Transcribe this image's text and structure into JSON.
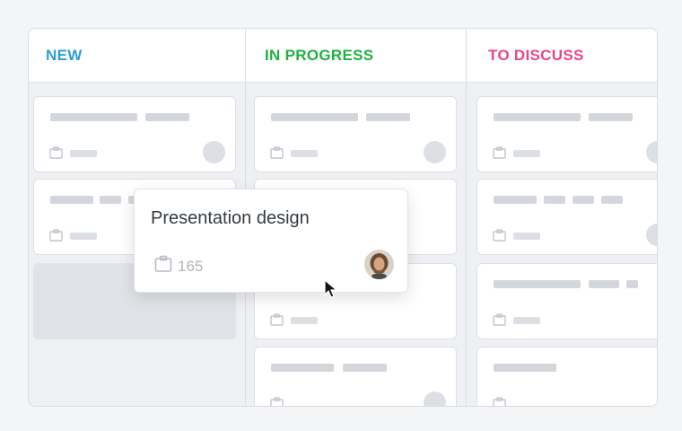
{
  "columns": [
    {
      "title": "NEW",
      "color": "#2a9fd8"
    },
    {
      "title": "IN PROGRESS",
      "color": "#1fb141"
    },
    {
      "title": "TO DISCUSS",
      "color": "#e8478b"
    }
  ],
  "dragged_card": {
    "title": "Presentation design",
    "count": "165",
    "icon": "clipboard-icon"
  },
  "colors": {
    "placeholder_bar": "#d3d6db",
    "board_bg": "#eef0f3"
  }
}
